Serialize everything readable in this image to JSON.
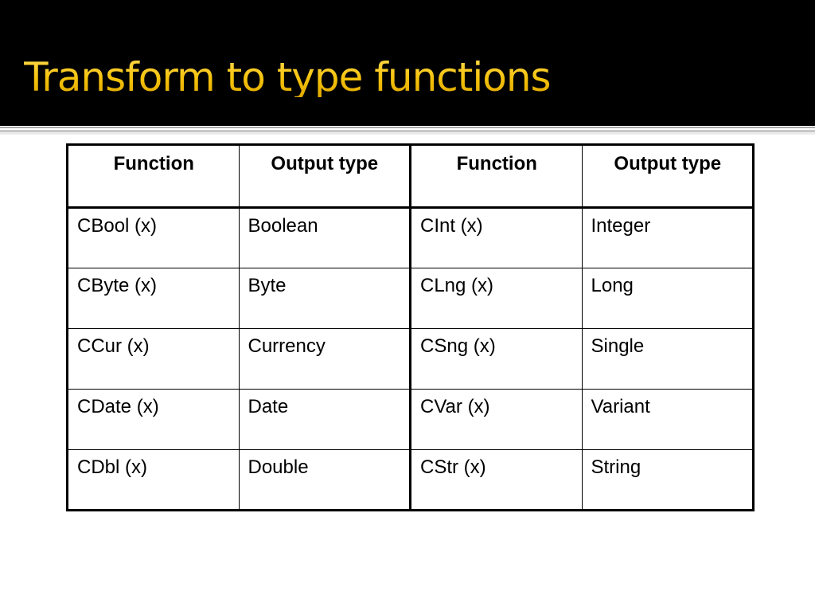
{
  "slide": {
    "title": "Transform to type functions",
    "title_color": "#F5C518",
    "header_background": "#000000"
  },
  "table": {
    "headers": [
      "Function",
      "Output type",
      "Function",
      "Output type"
    ],
    "rows": [
      [
        "CBool (x)",
        "Boolean",
        "CInt (x)",
        "Integer"
      ],
      [
        "CByte (x)",
        "Byte",
        "CLng (x)",
        "Long"
      ],
      [
        "CCur (x)",
        "Currency",
        "CSng (x)",
        "Single"
      ],
      [
        "CDate (x)",
        "Date",
        "CVar (x)",
        "Variant"
      ],
      [
        "CDbl (x)",
        "Double",
        "CStr (x)",
        "String"
      ]
    ]
  }
}
